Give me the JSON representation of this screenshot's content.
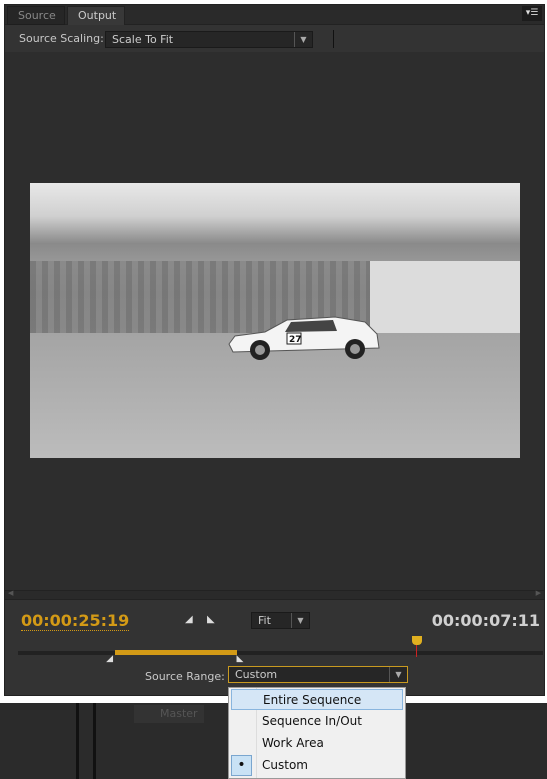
{
  "tabs": [
    {
      "label": "Source",
      "active": false
    },
    {
      "label": "Output",
      "active": true
    }
  ],
  "panel_menu_icon": "panel-menu-icon",
  "source_scaling": {
    "label": "Source Scaling:",
    "value": "Scale To Fit"
  },
  "timecode_current": "00:00:25:19",
  "timecode_duration": "00:00:07:11",
  "zoom_select": {
    "value": "Fit"
  },
  "source_range": {
    "label": "Source Range:",
    "value": "Custom",
    "options": [
      {
        "label": "Entire Sequence",
        "highlighted": true,
        "selected": false
      },
      {
        "label": "Sequence In/Out",
        "highlighted": false,
        "selected": false
      },
      {
        "label": "Work Area",
        "highlighted": false,
        "selected": false
      },
      {
        "label": "Custom",
        "highlighted": false,
        "selected": true
      }
    ]
  },
  "range": {
    "in_fraction": 0.185,
    "out_fraction": 0.418,
    "playhead_fraction": 0.76
  },
  "background_panel": {
    "tab": "Master"
  },
  "video": {
    "car_number": "27"
  },
  "colors": {
    "accent": "#d39a16",
    "timecode": "#d39a16",
    "playhead_line": "#cc2222"
  }
}
